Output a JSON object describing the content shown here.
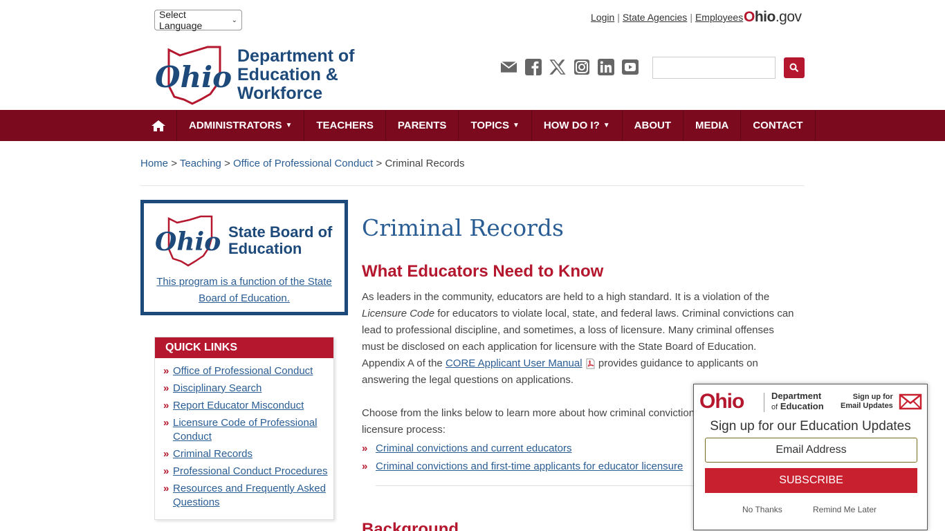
{
  "top": {
    "language_select": "Select Language",
    "util_links": [
      "Login",
      "State Agencies",
      "Employees"
    ],
    "util_sep": "|",
    "ohio_gov": {
      "o": "O",
      "hio": "hio",
      "gov": ".gov"
    }
  },
  "header": {
    "logo_lines": [
      "Department of",
      "Education &",
      "Workforce"
    ],
    "social_icons": [
      "email-icon",
      "facebook-icon",
      "x-twitter-icon",
      "instagram-icon",
      "linkedin-icon",
      "youtube-icon"
    ],
    "search_placeholder": ""
  },
  "nav": {
    "items": [
      {
        "label": "ADMINISTRATORS",
        "caret": "▼"
      },
      {
        "label": "TEACHERS",
        "caret": ""
      },
      {
        "label": "PARENTS",
        "caret": ""
      },
      {
        "label": "TOPICS",
        "caret": "▼"
      },
      {
        "label": "HOW DO I?",
        "caret": "▼"
      },
      {
        "label": "ABOUT",
        "caret": ""
      },
      {
        "label": "MEDIA",
        "caret": ""
      },
      {
        "label": "CONTACT",
        "caret": ""
      }
    ]
  },
  "breadcrumb": {
    "items": [
      "Home",
      "Teaching",
      "Office of Professional Conduct"
    ],
    "current": "Criminal Records",
    "sep": ">"
  },
  "sidebar": {
    "sbe_title_lines": [
      "State Board of",
      "Education"
    ],
    "sbe_link": "This program is a function of the State Board of Education.",
    "quick_links_title": "QUICK LINKS",
    "quick_links": [
      "Office of Professional Conduct",
      "Disciplinary Search",
      "Report Educator Misconduct",
      "Licensure Code of Professional Conduct",
      "Criminal Records",
      "Professional Conduct Procedures",
      "Resources and Frequently Asked Questions"
    ],
    "bullet": "»"
  },
  "main": {
    "title": "Criminal Records",
    "subtitle": "What Educators Need to Know",
    "para1_a": "As leaders in the community, educators are held to a high standard. It is a violation of the ",
    "para1_em": "Licensure Code",
    "para1_b": " for educators to violate local, state, and federal laws. Criminal convictions can lead to professional discipline, and sometimes, a loss of licensure. Many criminal offenses must be disclosed on each application for licensure with the State Board of Education. Appendix A of the ",
    "para1_link": "CORE Applicant User Manual",
    "para1_c": " provides guidance to applicants on answering the legal questions on applications.",
    "para2": "Choose from the links below to learn more about how criminal convictions impact the licensure process:",
    "links": [
      "Criminal convictions and current educators",
      "Criminal convictions and first-time applicants for educator licensure"
    ],
    "next_heading": "Background"
  },
  "popup": {
    "logo": "Ohio",
    "dept_line1": "Department",
    "dept_line2_of": "of",
    "dept_line2": "Education",
    "signup_small_1": "Sign up for",
    "signup_small_2": "Email Updates",
    "heading": "Sign up for our Education Updates",
    "email_placeholder": "Email Address",
    "subscribe": "SUBSCRIBE",
    "no_thanks": "No Thanks",
    "remind": "Remind Me Later"
  },
  "colors": {
    "brand_red": "#b4172e",
    "nav_maroon": "#7b0a1f",
    "brand_blue": "#1d4a7a",
    "link_blue": "#2a5d94"
  }
}
